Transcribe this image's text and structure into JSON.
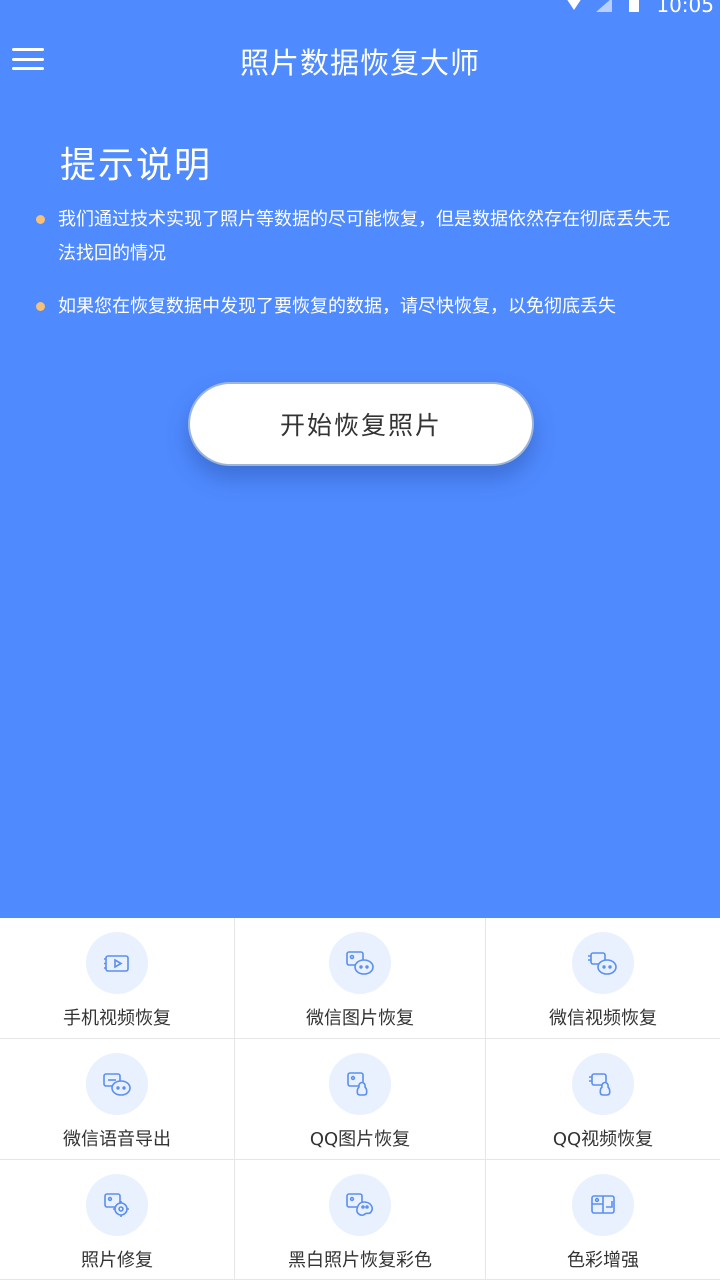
{
  "status_bar": {
    "time": "10:05"
  },
  "header": {
    "title": "照片数据恢复大师"
  },
  "notice": {
    "title": "提示说明",
    "items": [
      "我们通过技术实现了照片等数据的尽可能恢复，但是数据依然存在彻底丢失无法找回的情况",
      "如果您在恢复数据中发现了要恢复的数据，请尽快恢复，以免彻底丢失"
    ]
  },
  "start_button": {
    "label": "开始恢复照片"
  },
  "features": [
    {
      "label": "手机视频恢复",
      "icon": "video-icon"
    },
    {
      "label": "微信图片恢复",
      "icon": "wechat-image-icon"
    },
    {
      "label": "微信视频恢复",
      "icon": "wechat-video-icon"
    },
    {
      "label": "微信语音导出",
      "icon": "wechat-voice-icon"
    },
    {
      "label": "QQ图片恢复",
      "icon": "qq-image-icon"
    },
    {
      "label": "QQ视频恢复",
      "icon": "qq-video-icon"
    },
    {
      "label": "照片修复",
      "icon": "photo-repair-icon"
    },
    {
      "label": "黑白照片恢复彩色",
      "icon": "colorize-icon"
    },
    {
      "label": "色彩增强",
      "icon": "color-enhance-icon"
    }
  ],
  "colors": {
    "primary": "#4f8afe",
    "bullet": "#f6c077",
    "icon_bg": "#e9f1fe",
    "icon_stroke": "#5b8ff0"
  }
}
